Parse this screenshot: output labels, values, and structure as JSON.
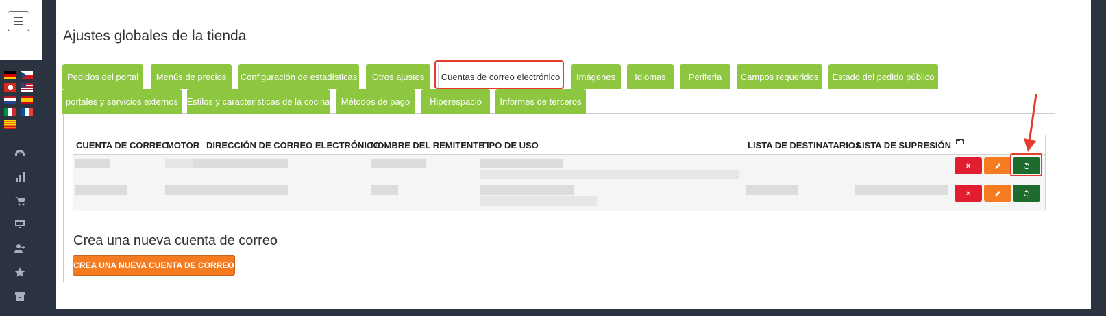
{
  "sidebar": {
    "menu_icon": "hamburger-icon",
    "flags": [
      "de",
      "cz",
      "ch",
      "us",
      "nl",
      "es",
      "it",
      "fr",
      "catalonia"
    ],
    "nav_icons": [
      "speedometer-icon",
      "bar-chart-icon",
      "cart-icon",
      "monitor-icon",
      "user-plus-icon",
      "star-icon",
      "archive-icon"
    ]
  },
  "page": {
    "title": "Ajustes globales de la tienda"
  },
  "tabs": [
    {
      "label": "Pedidos del portal"
    },
    {
      "label": "Menús de precios"
    },
    {
      "label": "Configuración de estadísticas"
    },
    {
      "label": "Otros ajustes"
    },
    {
      "label": "Cuentas de correo electrónico",
      "active": true
    },
    {
      "label": "Imágenes"
    },
    {
      "label": "Idiomas"
    },
    {
      "label": "Periferia"
    },
    {
      "label": "Campos requeridos"
    },
    {
      "label": "Estado del pedido público"
    },
    {
      "label": "portales y servicios externos"
    },
    {
      "label": "Estilos y características de la cocina"
    },
    {
      "label": "Métodos de pago"
    },
    {
      "label": "Hiperespacio"
    },
    {
      "label": "Informes de terceros"
    }
  ],
  "table": {
    "columns": [
      "CUENTA DE CORREO",
      "MOTOR",
      "DIRECCIÓN DE CORREO ELECTRÓNICO",
      "NOMBRE DEL REMITENTE",
      "TIPO DE USO",
      "LISTA DE DESTINATARIOS",
      "LISTA DE SUPRESIÓN",
      "keyboard-icon"
    ],
    "actions": {
      "delete": "×",
      "edit_icon": "pencil-icon",
      "sync_icon": "refresh-icon"
    }
  },
  "new_account": {
    "title": "Crea una nueva cuenta de correo",
    "button_label": "CREA UNA NUEVA CUENTA DE CORREO"
  },
  "colors": {
    "tab_green": "#8dc63f",
    "highlight_red": "#e53b2b",
    "delete_red": "#e21d30",
    "edit_orange": "#f47b20",
    "sync_green": "#1e6b2e",
    "sidebar_bg": "#2b3340"
  }
}
